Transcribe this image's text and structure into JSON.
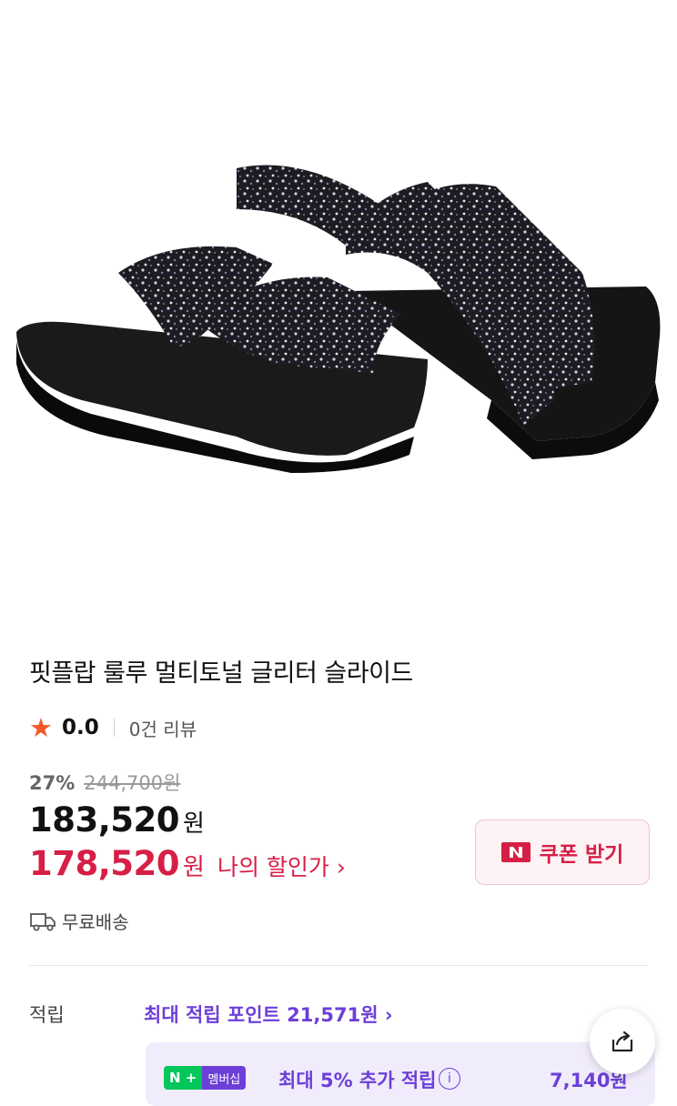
{
  "product": {
    "title": "핏플랍 룰루 멀티토널 글리터 슬라이드",
    "rating": "0.0",
    "review_count": "0건 리뷰",
    "discount_rate": "27%",
    "original_price": "244,700원",
    "price": "183,520",
    "price_unit": "원",
    "my_price": "178,520",
    "my_price_unit": "원",
    "my_price_link": "나의 할인가 ›"
  },
  "coupon": {
    "label": "쿠폰 받기",
    "icon": "naver-n-icon"
  },
  "shipping": {
    "label": "무료배송",
    "icon": "truck-icon"
  },
  "points": {
    "label": "적립",
    "max_link": "최대 적립 포인트 21,571원 ›",
    "membership_badge_left": "N +",
    "membership_badge_right": "멤버십",
    "membership_text": "최대 5% 추가 적립",
    "membership_amount": "7,140원"
  },
  "colors": {
    "accent_red": "#d61f46",
    "accent_purple": "#6c3fd8",
    "star": "#f25a2a",
    "naver_green": "#03c75a"
  }
}
